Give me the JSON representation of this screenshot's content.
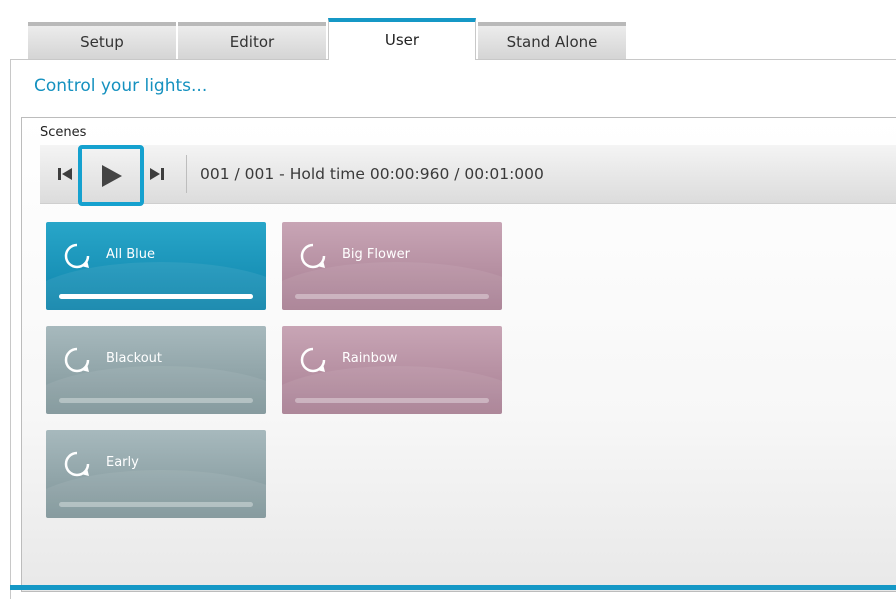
{
  "tabs": [
    {
      "label": "Setup",
      "active": false
    },
    {
      "label": "Editor",
      "active": false
    },
    {
      "label": "User",
      "active": true
    },
    {
      "label": "Stand Alone",
      "active": false
    }
  ],
  "subtitle": "Control your lights...",
  "scenes": {
    "title": "Scenes",
    "status": "001 / 001 -  Hold time 00:00:960 / 00:01:000",
    "items": [
      {
        "label": "All Blue",
        "color": "blue",
        "progress": 1.0
      },
      {
        "label": "Big Flower",
        "color": "pink",
        "progress": 0
      },
      {
        "label": "Blackout",
        "color": "grey",
        "progress": 0
      },
      {
        "label": "Rainbow",
        "color": "pink",
        "progress": 0
      },
      {
        "label": "Early",
        "color": "grey",
        "progress": 0
      }
    ]
  },
  "icons": {
    "prev": "skip-previous-icon",
    "play": "play-icon",
    "next": "skip-next-icon",
    "scene": "refresh-icon"
  },
  "colors": {
    "accent": "#1598c6",
    "tile_blue": "#1a93b8",
    "tile_pink": "#b893a5",
    "tile_grey": "#93a7ab"
  }
}
